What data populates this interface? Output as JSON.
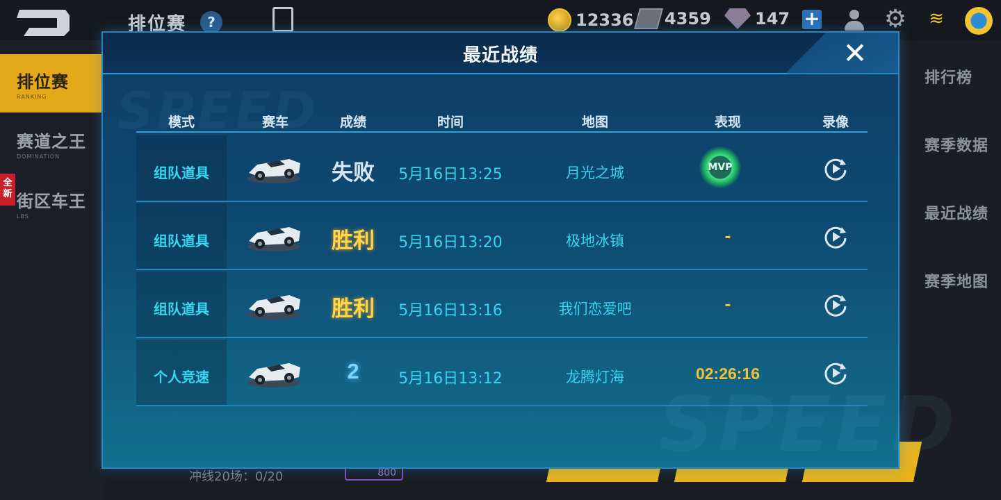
{
  "topbar": {
    "title": "排位赛",
    "help_label": "?",
    "coins": "12336",
    "tickets": "4359",
    "gems": "147",
    "plus_label": "+"
  },
  "leftnav": {
    "items": [
      {
        "label": "排位赛",
        "sub": "RANKING",
        "active": true
      },
      {
        "label": "赛道之王",
        "sub": "DOMINATION",
        "active": false
      },
      {
        "label": "街区车王",
        "sub": "LBS",
        "active": false
      }
    ],
    "badge": "全新"
  },
  "rightnav": {
    "items": [
      "排行榜",
      "赛季数据",
      "最近战绩",
      "赛季地图"
    ]
  },
  "bottom": {
    "progress_label": "冲线20场：0/20",
    "price": "800"
  },
  "modal": {
    "title": "最近战绩",
    "close_label": "✕",
    "columns": [
      "模式",
      "赛车",
      "成绩",
      "时间",
      "地图",
      "表现",
      "录像"
    ],
    "rows": [
      {
        "mode": "组队道具",
        "result": "失败",
        "time": "5月16日13:25",
        "map": "月光之城",
        "performance": "MVP"
      },
      {
        "mode": "组队道具",
        "result": "胜利",
        "time": "5月16日13:20",
        "map": "极地冰镇",
        "performance": "-"
      },
      {
        "mode": "组队道具",
        "result": "胜利",
        "time": "5月16日13:16",
        "map": "我们恋爱吧",
        "performance": "-"
      },
      {
        "mode": "个人竞速",
        "result": "2",
        "time": "5月16日13:12",
        "map": "龙腾灯海",
        "performance": "02:26:16"
      }
    ]
  },
  "colors": {
    "accent": "#e3a91a",
    "modal_bg": "#0e4a72",
    "cyan_text": "#38d5ee",
    "gold_text": "#ffd64a",
    "mvp_green": "#42e28d"
  }
}
